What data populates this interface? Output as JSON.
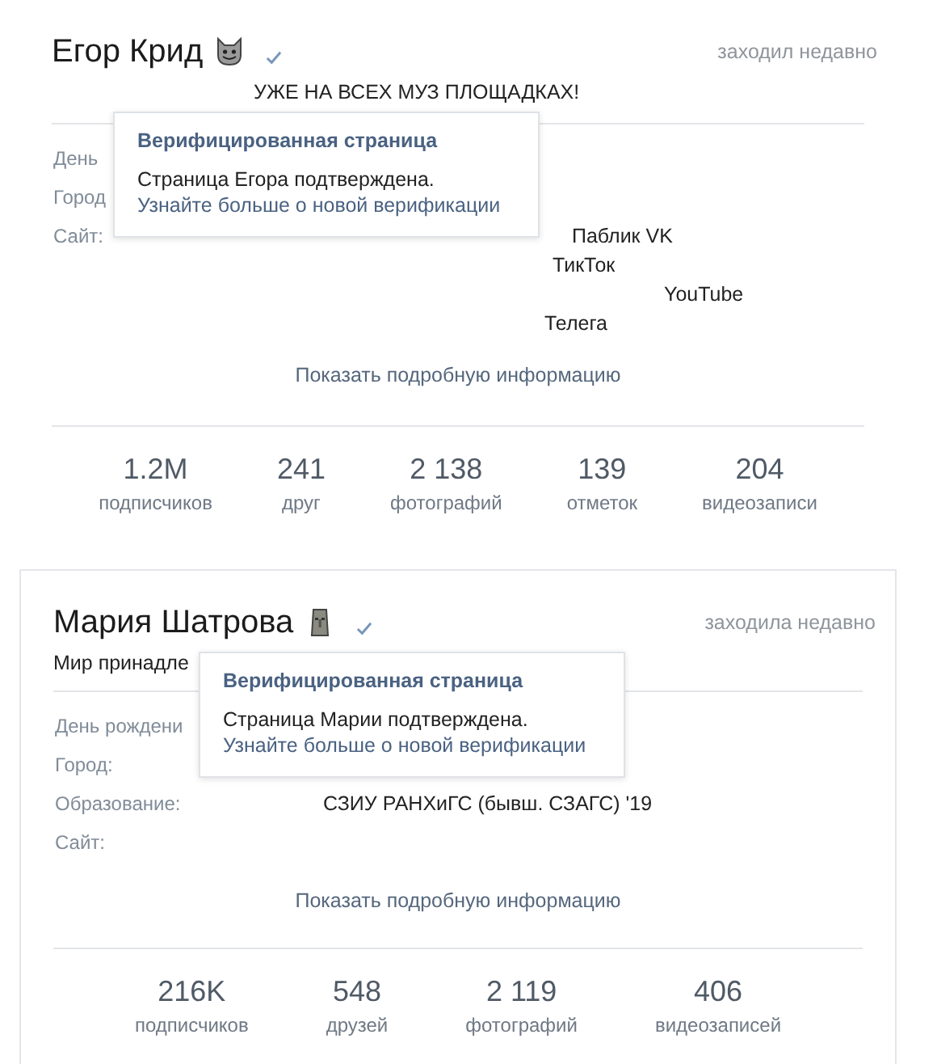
{
  "profiles": [
    {
      "name": "Егор Крид",
      "verified": true,
      "last_seen": "заходил недавно",
      "status": "УЖЕ НА ВСЕХ МУЗ ПЛОЩАДКАХ!",
      "info": [
        {
          "label": "День"
        },
        {
          "label": "Город"
        },
        {
          "label": "Сайт:",
          "links": [
            "Паблик VK",
            "ТикТок",
            "YouTube",
            "Телега"
          ]
        }
      ],
      "show_more": "Показать подробную информацию",
      "tooltip": {
        "title": "Верифицированная страница",
        "text": "Страница Егора подтверждена.",
        "link": "Узнайте больше о новой верификации"
      },
      "counters": [
        {
          "value": "1.2M",
          "label": "подписчиков"
        },
        {
          "value": "241",
          "label": "друг"
        },
        {
          "value": "2 138",
          "label": "фотографий"
        },
        {
          "value": "139",
          "label": "отметок"
        },
        {
          "value": "204",
          "label": "видеозаписи"
        }
      ]
    },
    {
      "name": "Мария Шатрова",
      "verified": true,
      "last_seen": "заходила недавно",
      "status": "Мир принадле",
      "info": [
        {
          "label": "День рождени"
        },
        {
          "label": "Город:"
        },
        {
          "label": "Образование:",
          "value": "СЗИУ РАНХиГС (бывш. СЗАГС) '19"
        },
        {
          "label": "Сайт:"
        }
      ],
      "show_more": "Показать подробную информацию",
      "tooltip": {
        "title": "Верифицированная страница",
        "text": "Страница Марии подтверждена.",
        "link": "Узнайте больше о новой верификации"
      },
      "counters": [
        {
          "value": "216K",
          "label": "подписчиков"
        },
        {
          "value": "548",
          "label": "друзей"
        },
        {
          "value": "2 119",
          "label": "фотографий"
        },
        {
          "value": "406",
          "label": "видеозаписей"
        }
      ]
    }
  ]
}
